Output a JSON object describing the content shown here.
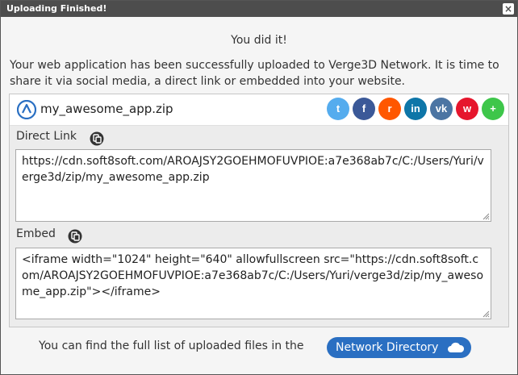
{
  "window": {
    "title": "Uploading Finished!",
    "close_glyph": "×"
  },
  "heading": "You did it!",
  "intro": "Your web application has been successfully uploaded to Verge3D Network. It is time to share it via social media, a direct link or embedded into your website.",
  "app": {
    "filename": "my_awesome_app.zip",
    "logo_icon": "verge3d-logo-icon"
  },
  "socials": [
    {
      "name": "twitter-icon",
      "glyph": "t",
      "color": "#55acee"
    },
    {
      "name": "facebook-icon",
      "glyph": "f",
      "color": "#3b5998"
    },
    {
      "name": "reddit-icon",
      "glyph": "r",
      "color": "#ff5700"
    },
    {
      "name": "linkedin-icon",
      "glyph": "in",
      "color": "#0e76a8"
    },
    {
      "name": "vk-icon",
      "glyph": "vk",
      "color": "#4c75a3"
    },
    {
      "name": "weibo-icon",
      "glyph": "w",
      "color": "#e6162d"
    },
    {
      "name": "xing-icon",
      "glyph": "+",
      "color": "#3ec64a"
    }
  ],
  "direct_link": {
    "label": "Direct Link",
    "value": "https://cdn.soft8soft.com/AROAJSY2GOEHMOFUVPIOE:a7e368ab7c/C:/Users/Yuri/verge3d/zip/my_awesome_app.zip"
  },
  "embed": {
    "label": "Embed",
    "value": "<iframe width=\"1024\" height=\"640\" allowfullscreen src=\"https://cdn.soft8soft.com/AROAJSY2GOEHMOFUVPIOE:a7e368ab7c/C:/Users/Yuri/verge3d/zip/my_awesome_app.zip\"></iframe>"
  },
  "footer": {
    "text": "You can find the full list of uploaded files in the",
    "button_label": "Network Directory"
  }
}
